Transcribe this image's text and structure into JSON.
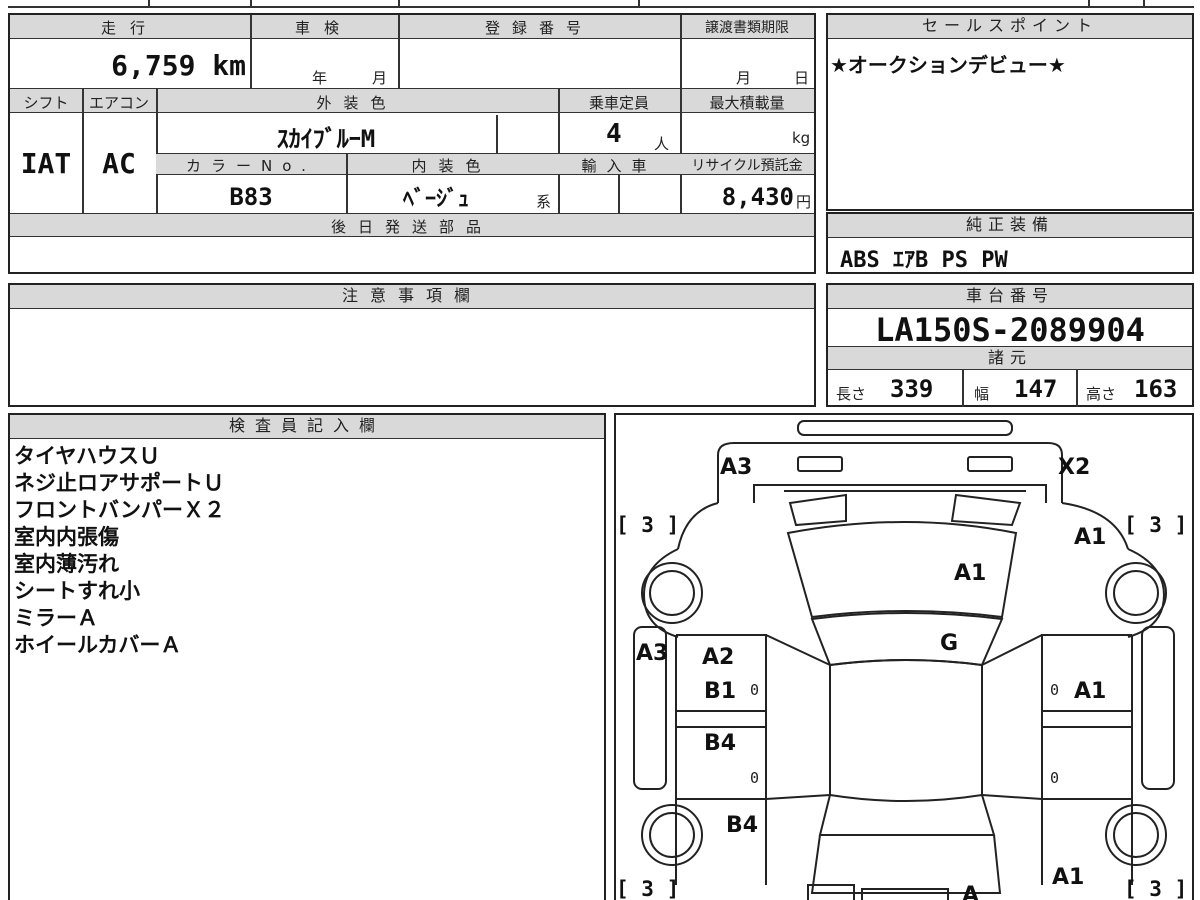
{
  "vehicle_info": {
    "mileage_label": "走行",
    "mileage_value": "6,759 km",
    "shaken_label": "車検",
    "shaken_year": "年",
    "shaken_month": "月",
    "registration_label": "登録番号",
    "transfer_deadline_label": "譲渡書類期限",
    "transfer_month": "月",
    "transfer_day": "日",
    "shift_label": "シフト",
    "shift_value": "IAT",
    "aircon_label": "エアコン",
    "aircon_value": "AC",
    "exterior_color_label": "外装色",
    "exterior_color_value": "ｽｶｲﾌﾞﾙｰM",
    "color_no_label": "カラーNo.",
    "color_no_value": "B83",
    "interior_color_label": "内装色",
    "interior_color_value": "ﾍﾞｰｼﾞｭ",
    "interior_suffix": "系",
    "capacity_label": "乗車定員",
    "capacity_value": "4",
    "capacity_unit": "人",
    "max_load_label": "最大積載量",
    "max_load_unit": "kg",
    "import_label": "輸入車",
    "recycle_label": "リサイクル預託金",
    "recycle_value": "8,430",
    "recycle_unit": "円",
    "later_parts_label": "後日発送部品"
  },
  "sales_point": {
    "title": "セールスポイント",
    "text": "★オークションデビュー★"
  },
  "standard_equipment": {
    "title": "純正装備",
    "text": "ABS ｴｱB PS PW"
  },
  "notes": {
    "title": "注意事項欄"
  },
  "chassis": {
    "title": "車台番号",
    "value": "LA150S-2089904"
  },
  "specs": {
    "title": "諸元",
    "length_label": "長さ",
    "length_value": "339",
    "width_label": "幅",
    "width_value": "147",
    "height_label": "高さ",
    "height_value": "163"
  },
  "inspector": {
    "title": "検査員記入欄",
    "lines": [
      "タイヤハウスＵ",
      "ネジ止ロアサポートＵ",
      "フロントバンパーＸ２",
      "室内内張傷",
      "室内薄汚れ",
      "シートすれ小",
      "ミラーＡ",
      "ホイールカバーＡ"
    ]
  },
  "diagram": {
    "marks": {
      "front_left": "A3",
      "front_right": "X2",
      "hood": "A1",
      "right_fender": "A1",
      "windshield": "G",
      "left_side": "A3",
      "front_door_left_1": "A2",
      "front_door_left_2": "B1",
      "front_door_right": "A1",
      "rear_door_left": "B4",
      "rear_left": "B4",
      "rear_right": "A1",
      "rear_center": "A"
    },
    "tires": {
      "front_left": "[ 3 ]",
      "front_right": "[ 3 ]",
      "rear_left": "[ 3 ]",
      "rear_right": "[ 3 ]"
    },
    "zero": "0"
  }
}
